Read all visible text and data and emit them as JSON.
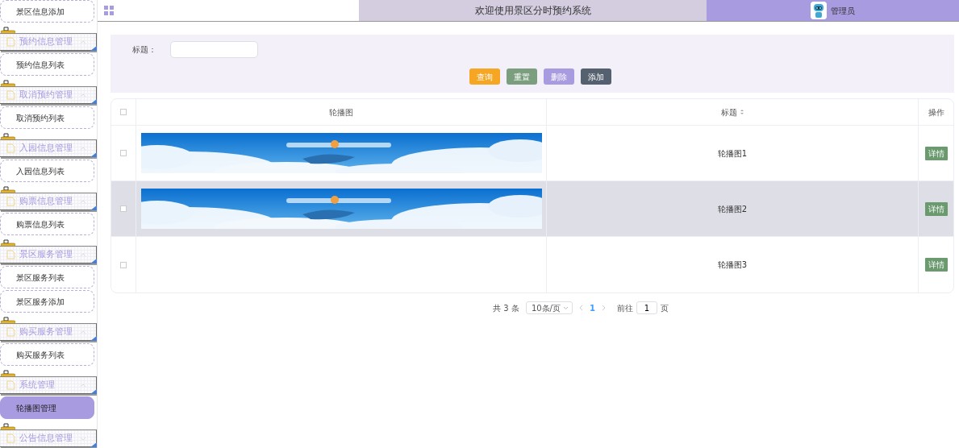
{
  "sidebar": {
    "items": [
      {
        "kind": "link",
        "label": "景区信息添加",
        "selected": false
      },
      {
        "kind": "group",
        "label": "预约信息管理",
        "expanded": true,
        "children": [
          {
            "kind": "link",
            "label": "预约信息列表",
            "selected": false
          }
        ]
      },
      {
        "kind": "group",
        "label": "取消预约管理",
        "expanded": true,
        "children": [
          {
            "kind": "link",
            "label": "取消预约列表",
            "selected": false
          }
        ]
      },
      {
        "kind": "group",
        "label": "入园信息管理",
        "expanded": true,
        "children": [
          {
            "kind": "link",
            "label": "入园信息列表",
            "selected": false
          }
        ]
      },
      {
        "kind": "group",
        "label": "购票信息管理",
        "expanded": true,
        "children": [
          {
            "kind": "link",
            "label": "购票信息列表",
            "selected": false
          }
        ]
      },
      {
        "kind": "group",
        "label": "景区服务管理",
        "expanded": true,
        "children": [
          {
            "kind": "link",
            "label": "景区服务列表",
            "selected": false
          },
          {
            "kind": "link",
            "label": "景区服务添加",
            "selected": false
          }
        ]
      },
      {
        "kind": "group",
        "label": "购买服务管理",
        "expanded": true,
        "children": [
          {
            "kind": "link",
            "label": "购买服务列表",
            "selected": false
          }
        ]
      },
      {
        "kind": "group",
        "label": "系统管理",
        "expanded": true,
        "children": [
          {
            "kind": "link",
            "label": "轮播图管理",
            "selected": true
          }
        ]
      },
      {
        "kind": "group",
        "label": "公告信息管理",
        "expanded": false
      }
    ]
  },
  "header": {
    "title": "欢迎使用景区分时预约系统",
    "user": "管理员"
  },
  "filter": {
    "label": "标题：",
    "buttons": [
      {
        "label": "查询",
        "kind": "search"
      },
      {
        "label": "重置",
        "kind": "reset"
      },
      {
        "label": "删除",
        "kind": "delete"
      },
      {
        "label": "添加",
        "kind": "add"
      }
    ]
  },
  "table": {
    "header_checked": false,
    "columns": [
      "轮播图",
      "标题",
      "操作"
    ],
    "rows": [
      {
        "checked": false,
        "highlighted": false,
        "title": "轮播图1",
        "action": "详情"
      },
      {
        "checked": false,
        "highlighted": true,
        "title": "轮播图2",
        "action": "详情"
      },
      {
        "checked": false,
        "highlighted": false,
        "title": "轮播图3",
        "action": "详情"
      }
    ]
  },
  "pagination": {
    "total": "共 3 条",
    "page_size": "10条/页",
    "pages": [
      {
        "label": "1",
        "selected": true
      }
    ],
    "goto_label": "前往",
    "goto_value": "1",
    "goto_suffix": "页"
  }
}
